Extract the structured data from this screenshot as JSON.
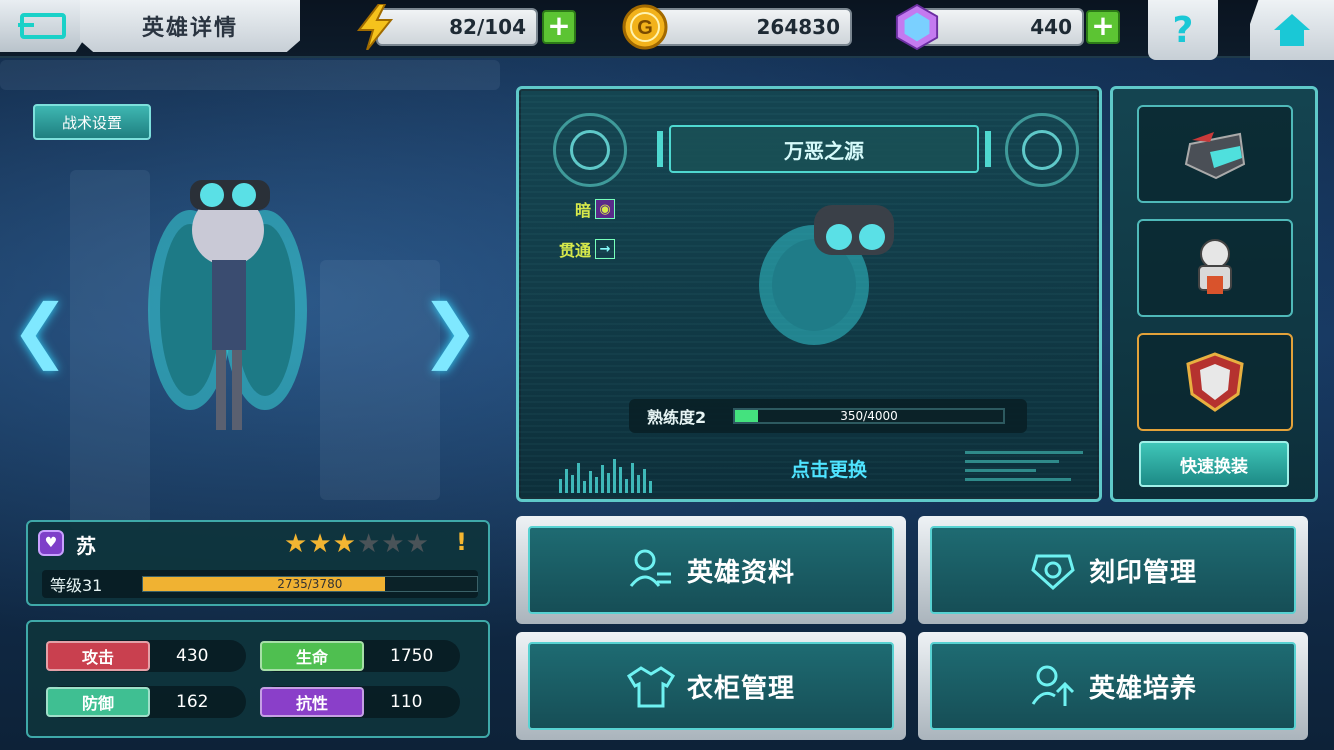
{
  "header": {
    "title": "英雄详情",
    "stamina": "82/104",
    "gold": "264830",
    "gems": "440"
  },
  "tactics_label": "战术设置",
  "weapon": {
    "name": "万恶之源",
    "element": "暗",
    "trait": "贯通",
    "proficiency_label": "熟练度2",
    "proficiency_value": "350/4000",
    "proficiency_fraction": 0.0875,
    "change_label": "点击更换"
  },
  "quick_equip_label": "快速换装",
  "hero": {
    "name": "苏",
    "stars_filled": 3,
    "stars_total": 6,
    "level_label": "等级31",
    "exp_text": "2735/3780",
    "exp_fraction": 0.7235
  },
  "stats": [
    {
      "label": "攻击",
      "value": "430",
      "color": "#c9404f"
    },
    {
      "label": "生命",
      "value": "1750",
      "color": "#4fbf50"
    },
    {
      "label": "防御",
      "value": "162",
      "color": "#3fbf92"
    },
    {
      "label": "抗性",
      "value": "110",
      "color": "#8a3fc9"
    }
  ],
  "buttons": {
    "hero_info": "英雄资料",
    "imprint": "刻印管理",
    "wardrobe": "衣柜管理",
    "train": "英雄培养"
  },
  "colors": {
    "accent": "#5fc9c9",
    "highlight": "#4fe4ff",
    "gold": "#f0b232"
  }
}
